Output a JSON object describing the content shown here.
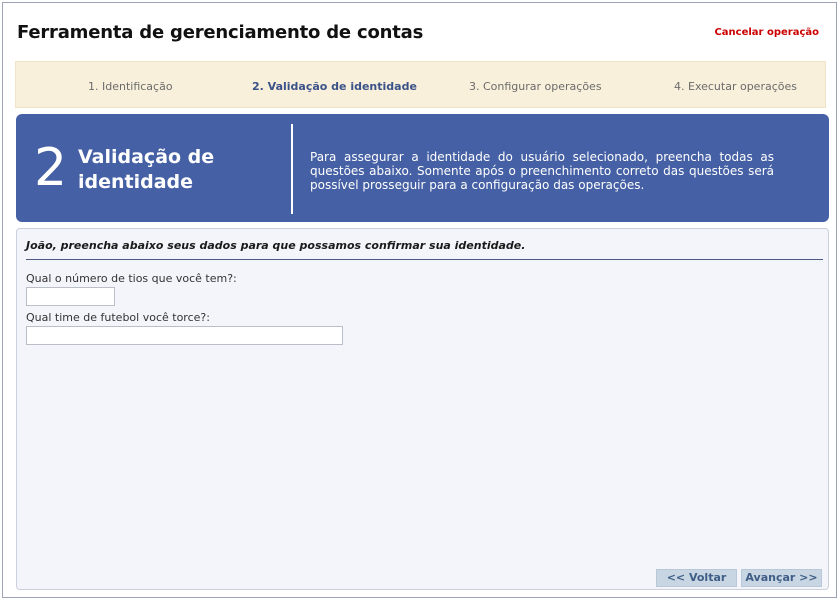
{
  "header": {
    "title": "Ferramenta de gerenciamento de contas",
    "cancel_label": "Cancelar operação"
  },
  "steps": [
    {
      "label": "1. Identificação",
      "active": false
    },
    {
      "label": "2. Validação de identidade",
      "active": true
    },
    {
      "label": "3. Configurar operações",
      "active": false
    },
    {
      "label": "4. Executar operações",
      "active": false
    }
  ],
  "banner": {
    "number": "2",
    "title": "Validação de identidade",
    "description": "Para assegurar a identidade do usuário selecionado, preencha todas as questões abaixo. Somente após o preenchimento correto das questões será possível prosseguir para a configuração das operações."
  },
  "form": {
    "intro": "João, preencha abaixo seus dados para que possamos confirmar sua identidade.",
    "questions": [
      {
        "label": "Qual o número de tios que você tem?:",
        "value": ""
      },
      {
        "label": "Qual time de futebol você torce?:",
        "value": ""
      }
    ]
  },
  "buttons": {
    "back_label": "<< Voltar",
    "next_label": "Avançar >>"
  },
  "colors": {
    "banner_bg": "#4560a4",
    "steps_bg": "#f9f0dc",
    "active_step": "#3a5288",
    "cancel_link": "#cc0000",
    "button_bg": "#c8d6e3"
  }
}
